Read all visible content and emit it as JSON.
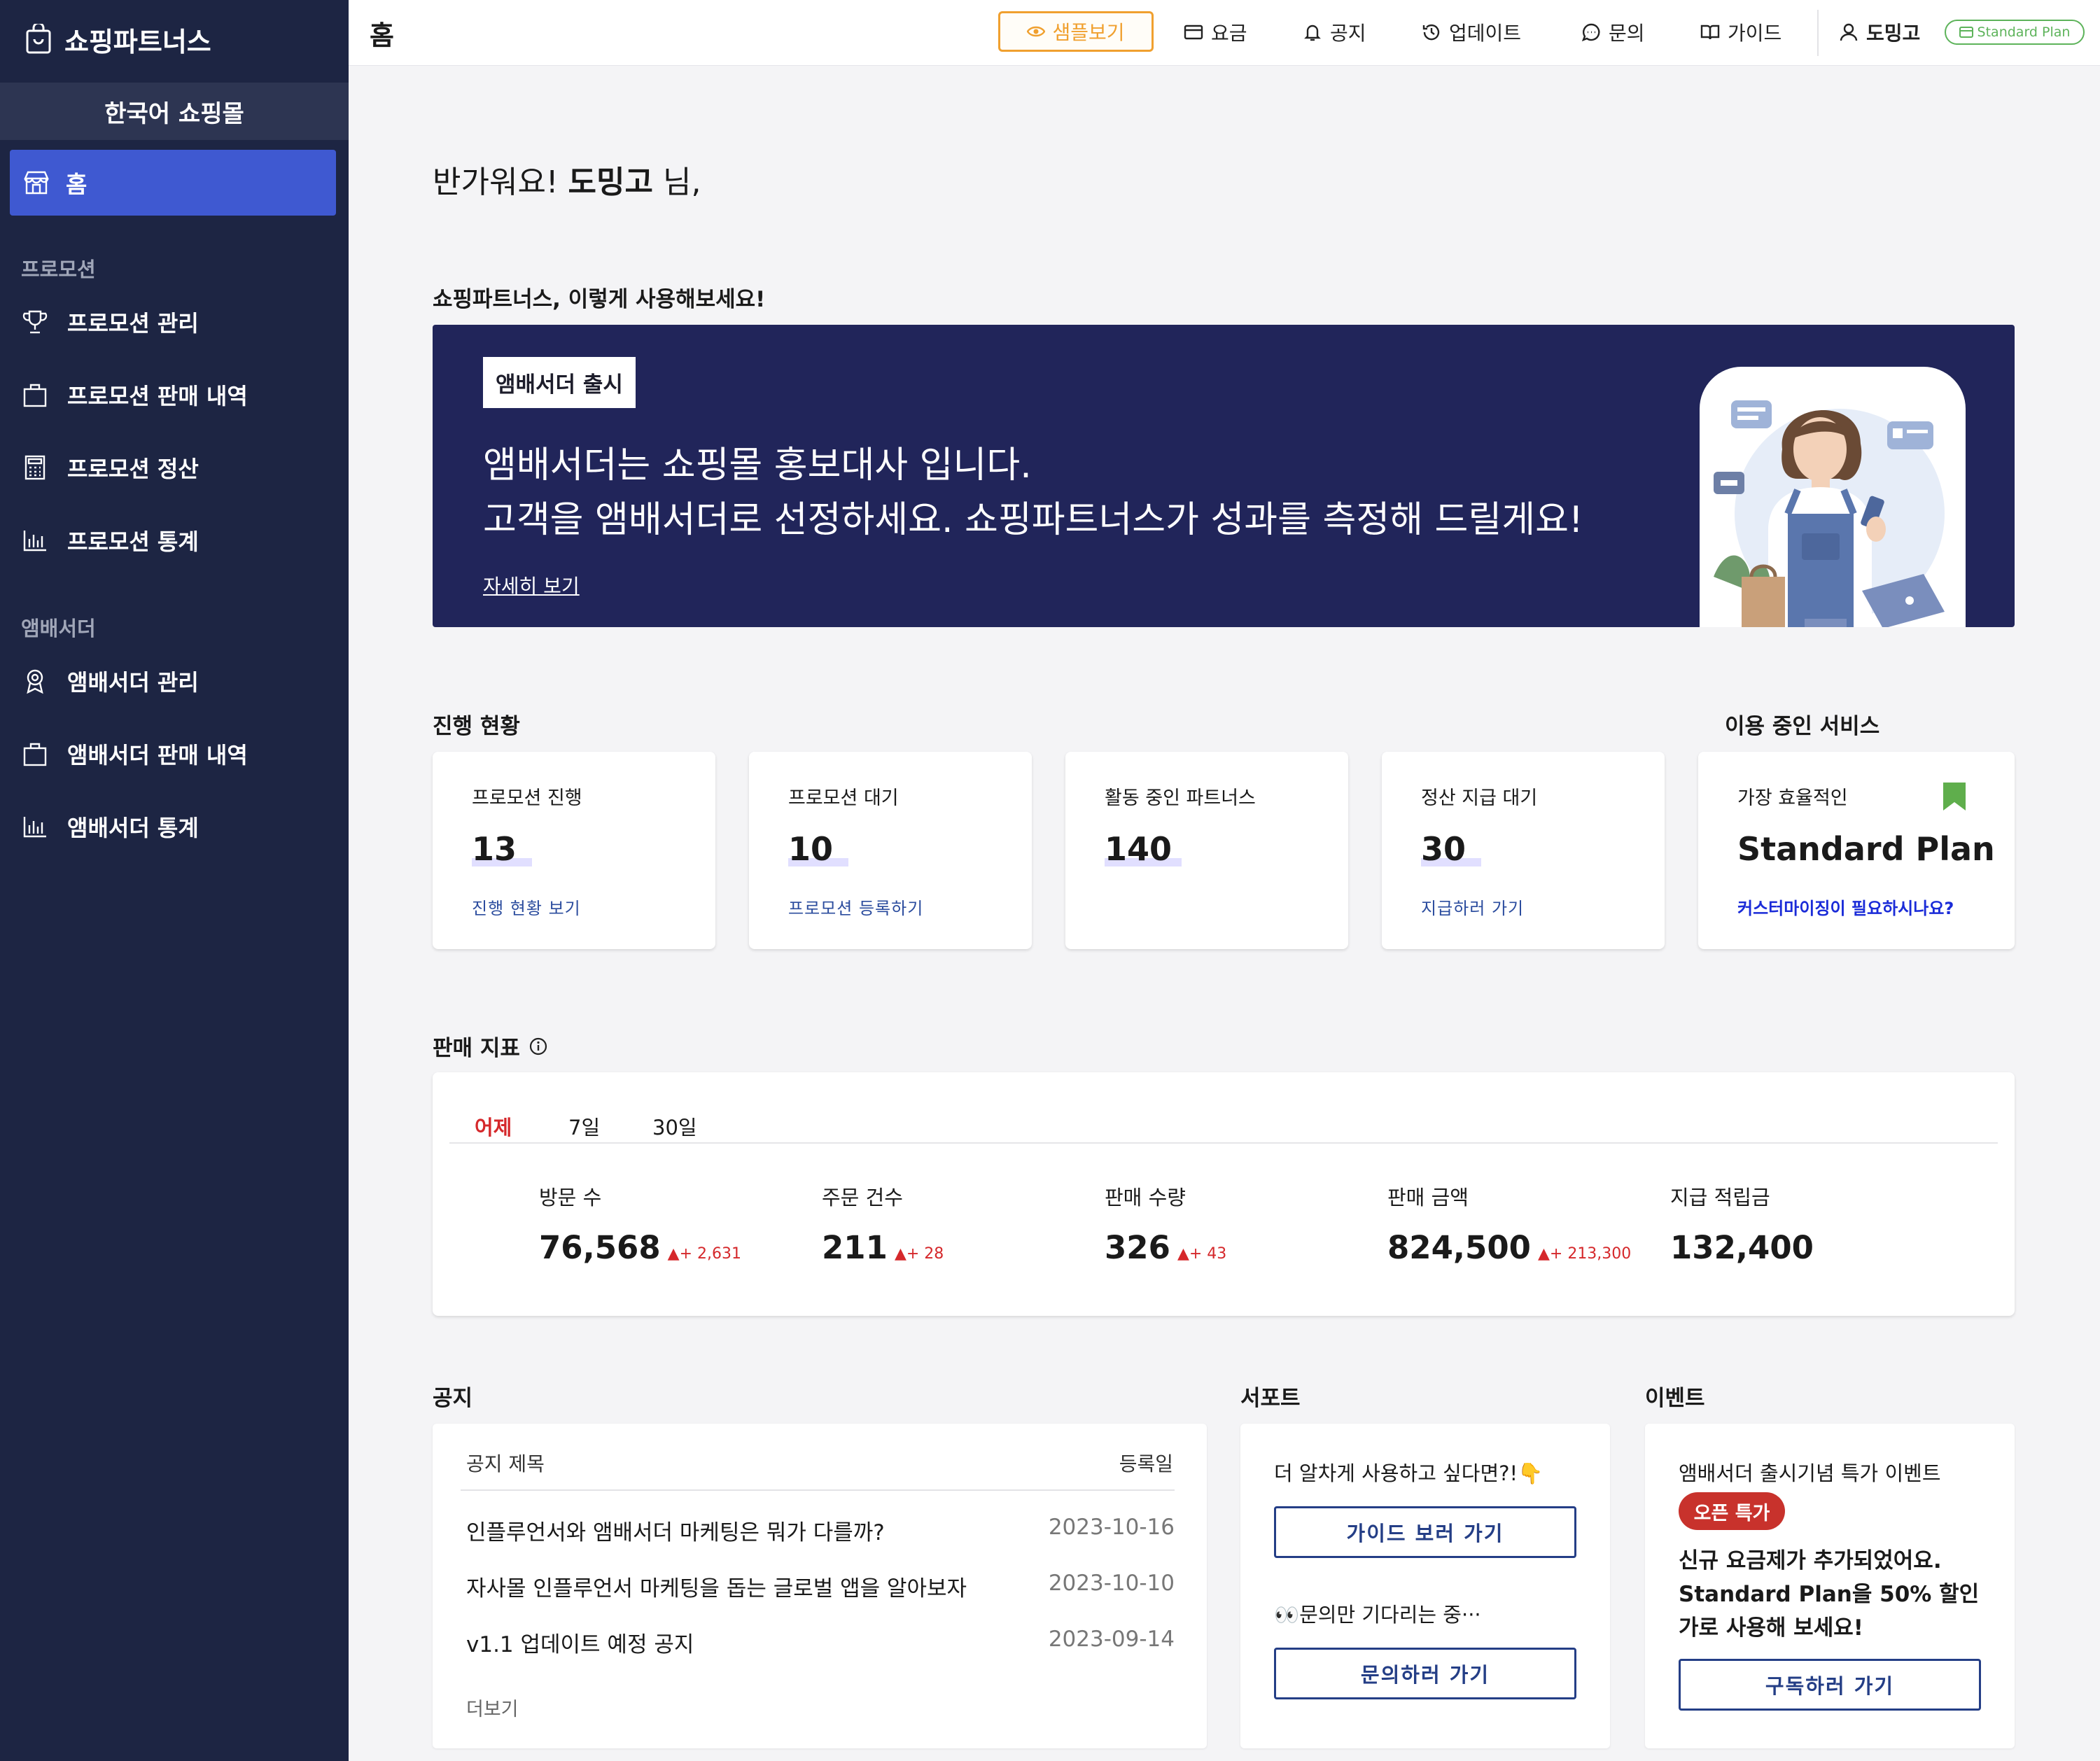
{
  "sidebar": {
    "brand": "쇼핑파트너스",
    "shop_name": "한국어 쇼핑몰",
    "home": "홈",
    "sections": [
      {
        "title": "프로모션",
        "items": [
          "프로모션 관리",
          "프로모션 판매 내역",
          "프로모션 정산",
          "프로모션 통계"
        ]
      },
      {
        "title": "앰배서더",
        "items": [
          "앰배서더 관리",
          "앰배서더 판매 내역",
          "앰배서더 통계"
        ]
      }
    ]
  },
  "topbar": {
    "title": "홈",
    "sample": "샘플보기",
    "links": [
      "요금",
      "공지",
      "업데이트",
      "문의",
      "가이드"
    ],
    "user": "도밍고",
    "plan": "Standard Plan"
  },
  "greeting": {
    "prefix": "반가워요! ",
    "name": "도밍고",
    "suffix": " 님,"
  },
  "guide_label": "쇼핑파트너스, 이렇게 사용해보세요!",
  "banner": {
    "tag": "앰배서더 출시",
    "line1": "앰배서더는 쇼핑몰 홍보대사 입니다.",
    "line2": "고객을 앰배서더로 선정하세요. 쇼핑파트너스가 성과를 측정해 드릴게요!",
    "link": "자세히 보기"
  },
  "progress": {
    "label": "진행 현황",
    "cards": [
      {
        "title": "프로모션 진행",
        "value": "13",
        "link": "진행 현황 보기"
      },
      {
        "title": "프로모션 대기",
        "value": "10",
        "link": "프로모션 등록하기"
      },
      {
        "title": "활동 중인 파트너스",
        "value": "140",
        "link": ""
      },
      {
        "title": "정산 지급 대기",
        "value": "30",
        "link": "지급하러 가기"
      }
    ]
  },
  "service": {
    "label": "이용 중인 서비스",
    "title": "가장 효율적인",
    "plan": "Standard Plan",
    "link": "커스터마이징이 필요하시나요?"
  },
  "metrics": {
    "label": "판매 지표",
    "tabs": [
      "어제",
      "7일",
      "30일"
    ],
    "active_tab": "어제",
    "items": [
      {
        "label": "방문 수",
        "value": "76,568",
        "delta": "+ 2,631"
      },
      {
        "label": "주문 건수",
        "value": "211",
        "delta": "+ 28"
      },
      {
        "label": "판매 수량",
        "value": "326",
        "delta": "+ 43"
      },
      {
        "label": "판매 금액",
        "value": "824,500",
        "delta": "+ 213,300"
      },
      {
        "label": "지급 적립금",
        "value": "132,400",
        "delta": ""
      }
    ]
  },
  "notice": {
    "label": "공지",
    "col_title": "공지 제목",
    "col_date": "등록일",
    "rows": [
      {
        "title": "인플루언서와 앰배서더 마케팅은 뭐가 다를까?",
        "date": "2023-10-16"
      },
      {
        "title": "자사몰 인플루언서 마케팅을 돕는 글로벌 앱을 알아보자",
        "date": "2023-10-10"
      },
      {
        "title": "v1.1 업데이트 예정 공지",
        "date": "2023-09-14"
      }
    ],
    "more": "더보기"
  },
  "support": {
    "label": "서포트",
    "text1": "더 알차게 사용하고 싶다면?!👇",
    "btn1": "가이드 보러 가기",
    "text2": "👀문의만 기다리는 중···",
    "btn2": "문의하러 가기"
  },
  "event": {
    "label": "이벤트",
    "title": "앰배서더 출시기념 특가 이벤트",
    "badge": "오픈 특가",
    "body": "신규 요금제가 추가되었어요. Standard Plan을 50% 할인가로 사용해 보세요!",
    "btn": "구독하러 가기"
  },
  "colors": {
    "sidebar_bg": "#1d2543",
    "active_nav": "#3f59d1",
    "banner_bg": "#21255a",
    "accent_orange": "#f0a02f",
    "positive_delta": "#d5282b",
    "plan_green": "#5db35a",
    "button_navy": "#243e86"
  }
}
